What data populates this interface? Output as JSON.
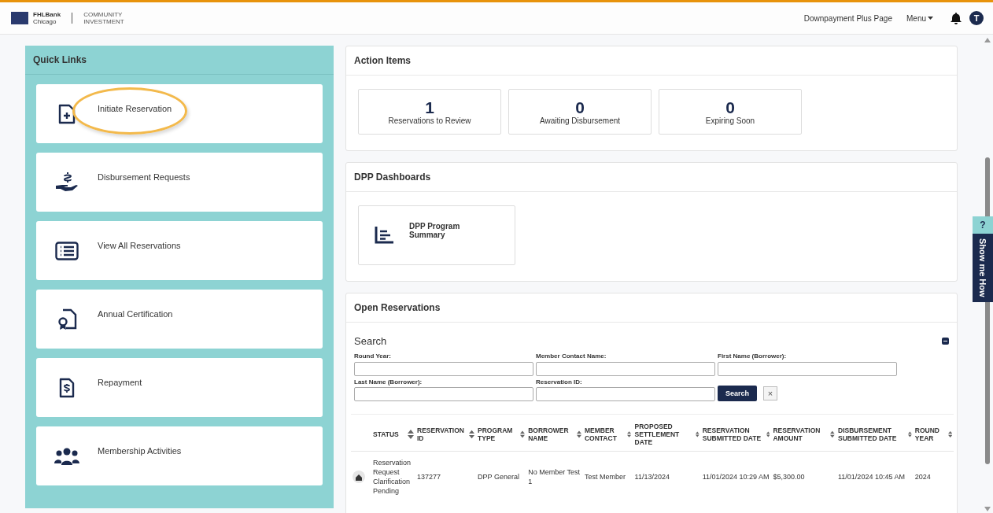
{
  "header": {
    "brand": "FHLBank",
    "brand_sub": "Chicago",
    "division_1": "COMMUNITY",
    "division_2": "INVESTMENT",
    "nav_link": "Downpayment Plus Page",
    "menu": "Menu",
    "avatar": "T"
  },
  "quick_links": {
    "title": "Quick Links",
    "items": [
      {
        "label": "Initiate Reservation",
        "kind": "file-plus",
        "highlighted": true
      },
      {
        "label": "Disbursement Requests",
        "kind": "hand-dollar",
        "highlighted": false
      },
      {
        "label": "View All Reservations",
        "kind": "list",
        "highlighted": false
      },
      {
        "label": "Annual Certification",
        "kind": "certificate",
        "highlighted": false
      },
      {
        "label": "Repayment",
        "kind": "receipt",
        "highlighted": false
      },
      {
        "label": "Membership Activities",
        "kind": "people",
        "highlighted": false
      }
    ]
  },
  "action_items": {
    "title": "Action Items",
    "tiles": [
      {
        "count": "1",
        "label": "Reservations to Review"
      },
      {
        "count": "0",
        "label": "Awaiting Disbursement"
      },
      {
        "count": "0",
        "label": "Expiring Soon"
      }
    ]
  },
  "dashboards": {
    "title": "DPP Dashboards",
    "tiles": [
      {
        "label": "DPP Program Summary"
      }
    ]
  },
  "open_reservations": {
    "title": "Open Reservations",
    "search": {
      "title": "Search",
      "fields": [
        {
          "label": "Round Year:"
        },
        {
          "label": "Member Contact Name:"
        },
        {
          "label": "First Name (Borrower):"
        },
        {
          "label": "Last Name (Borrower):"
        },
        {
          "label": "Reservation ID:"
        }
      ],
      "button": "Search",
      "clear": "×"
    },
    "table": {
      "columns": [
        "STATUS",
        "RESERVATION ID",
        "PROGRAM TYPE",
        "BORROWER NAME",
        "MEMBER CONTACT",
        "PROPOSED SETTLEMENT DATE",
        "RESERVATION SUBMITTED DATE",
        "RESERVATION AMOUNT",
        "DISBURSEMENT SUBMITTED DATE",
        "ROUND YEAR"
      ],
      "rows": [
        [
          "Reservation Request Clarification Pending",
          "137277",
          "DPP General",
          "No Member Test 1",
          "Test Member",
          "11/13/2024",
          "11/01/2024 10:29 AM",
          "$5,300.00",
          "11/01/2024 10:45 AM",
          "2024"
        ]
      ]
    }
  },
  "help_tab": {
    "icon": "?",
    "label": "Show me How"
  }
}
